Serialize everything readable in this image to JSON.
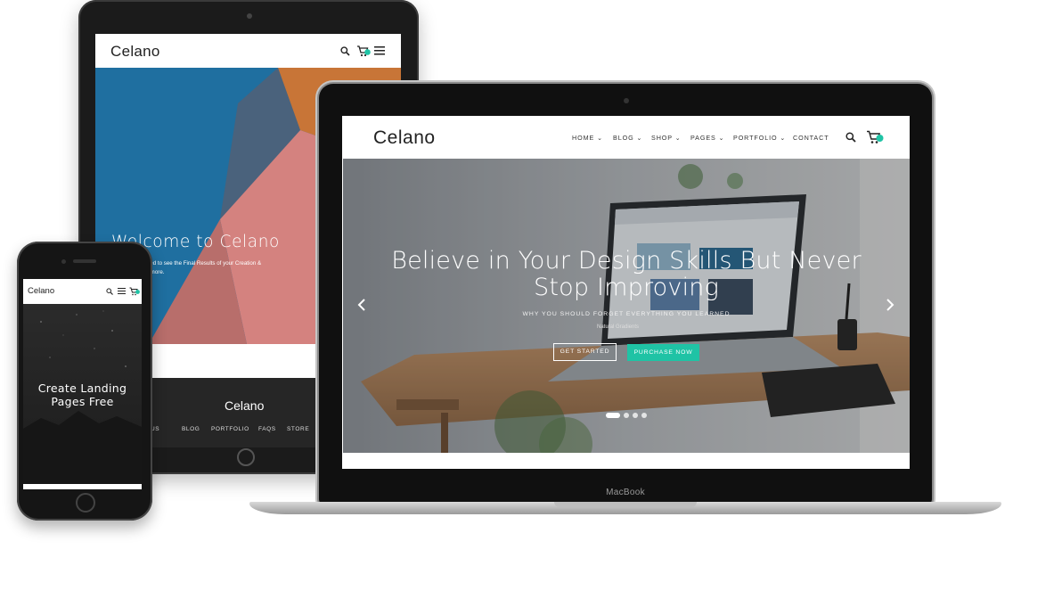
{
  "tablet": {
    "logo": "Celano",
    "hero_title": "Welcome to Celano",
    "hero_subtitle": "You'll be surprised to see the Final Results of your Creation & would crave for more.",
    "footer_logo": "Celano",
    "footer_nav": [
      "US",
      "BLOG",
      "PORTFOLIO",
      "FAQS",
      "STORE"
    ],
    "cart_count": "0",
    "icons": [
      "search-icon",
      "cart-icon",
      "menu-icon"
    ]
  },
  "laptop": {
    "brand": "MacBook",
    "logo": "Celano",
    "nav": [
      "HOME",
      "BLOG",
      "SHOP",
      "PAGES",
      "PORTFOLIO",
      "CONTACT"
    ],
    "cart_count": "0",
    "hero_title_line1": "Believe in Your Design Skills But Never",
    "hero_title_line2": "Stop Improving",
    "hero_subtitle": "WHY YOU SHOULD FORGET EVERYTHING YOU LEARNED",
    "btn_get_started": "GET STARTED",
    "btn_purchase": "PURCHASE NOW",
    "screen_text": "Natural Gradients",
    "slider_dots": 4,
    "active_dot": 1,
    "accent": "#1fc3a5"
  },
  "phone": {
    "logo": "Celano",
    "hero_title_line1": "Create Landing",
    "hero_title_line2": "Pages Free",
    "cart_count": "0"
  }
}
